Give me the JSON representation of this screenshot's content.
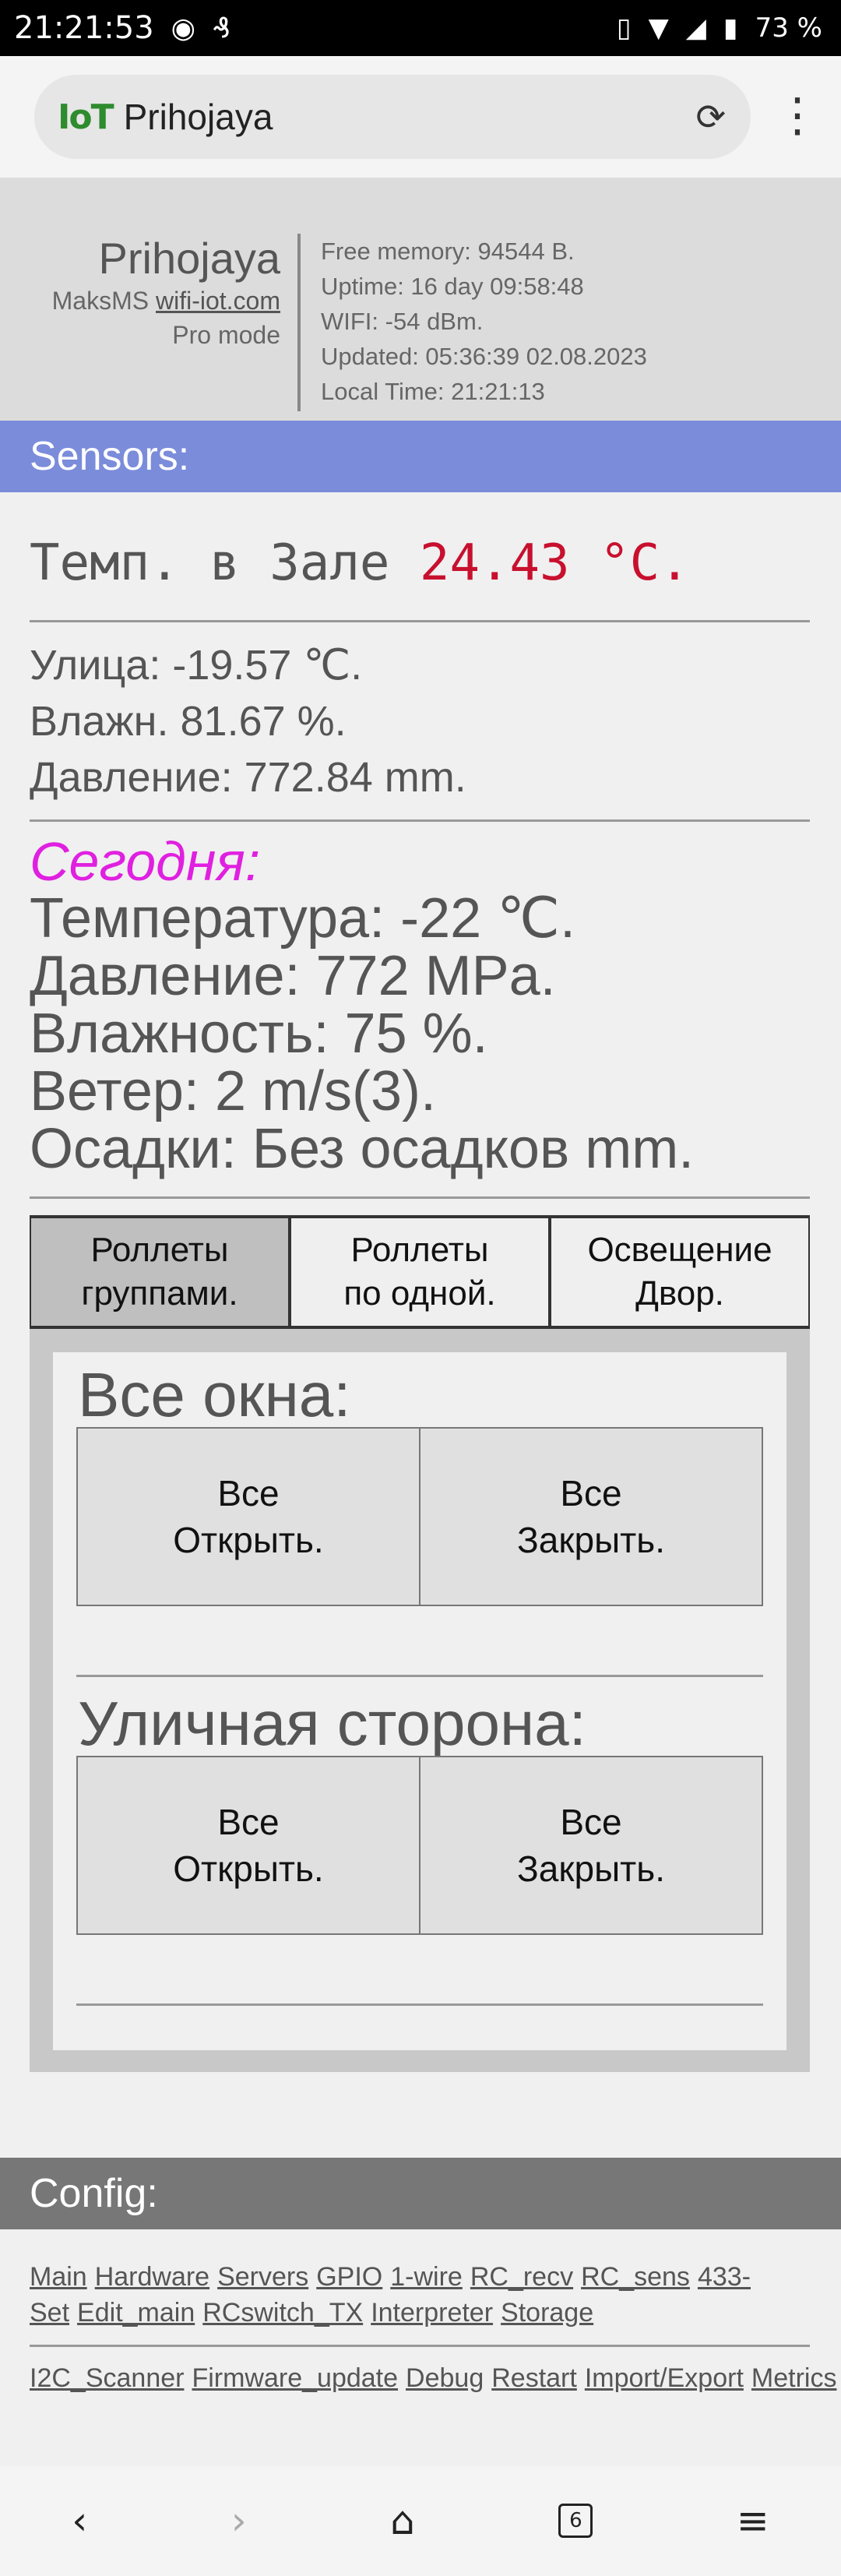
{
  "status": {
    "time": "21:21:53",
    "notif_icons": [
      "aperture-icon",
      "app-icon"
    ],
    "battery": "73 %"
  },
  "browser": {
    "logo": "IoT",
    "title": "Prihojaya"
  },
  "header": {
    "device_name": "Prihojaya",
    "author": "MaksMS",
    "site": "wifi-iot.com",
    "mode": "Pro mode",
    "free_memory": "Free memory: 94544 B.",
    "uptime": "Uptime: 16 day 09:58:48",
    "wifi": "WIFI: -54 dBm.",
    "updated": "Updated: 05:36:39 02.08.2023",
    "local_time": "Local Time: 21:21:13"
  },
  "sensors": {
    "title": "Sensors:",
    "temp_label": "Темп. в Зале",
    "temp_value": "24.43 °C.",
    "street": "Улица: -19.57 ℃.",
    "humidity": "Влажн. 81.67 %.",
    "pressure": "Давление: 772.84 mm."
  },
  "today": {
    "title": "Сегодня:",
    "temperature": "Температура: -22 ℃.",
    "pressure": "Давление: 772 MPa.",
    "humidity": "Влажность: 75 %.",
    "wind": "Ветер: 2 m/s(3).",
    "precip": "Осадки: Без осадков mm."
  },
  "tabs": [
    {
      "line1": "Роллеты",
      "line2": "группами."
    },
    {
      "line1": "Роллеты",
      "line2": "по одной."
    },
    {
      "line1": "Освещение",
      "line2": "Двор."
    }
  ],
  "groups": [
    {
      "title": "Все окна:",
      "open1": "Все",
      "open2": "Открыть.",
      "close1": "Все",
      "close2": "Закрыть."
    },
    {
      "title": "Уличная сторона:",
      "open1": "Все",
      "open2": "Открыть.",
      "close1": "Все",
      "close2": "Закрыть."
    }
  ],
  "config": {
    "title": "Config:",
    "links1": [
      "Main",
      "Hardware",
      "Servers",
      "GPIO",
      "1-wire",
      "RC_recv",
      "RC_sens",
      "433-Set",
      "Edit_main",
      "RCswitch_TX",
      "Interpreter",
      "Storage"
    ],
    "links2": [
      "I2C_Scanner",
      "Firmware_update",
      "Debug",
      "Restart",
      "Import/Export",
      "Metrics"
    ]
  },
  "nav": {
    "tabs_count": "6"
  }
}
